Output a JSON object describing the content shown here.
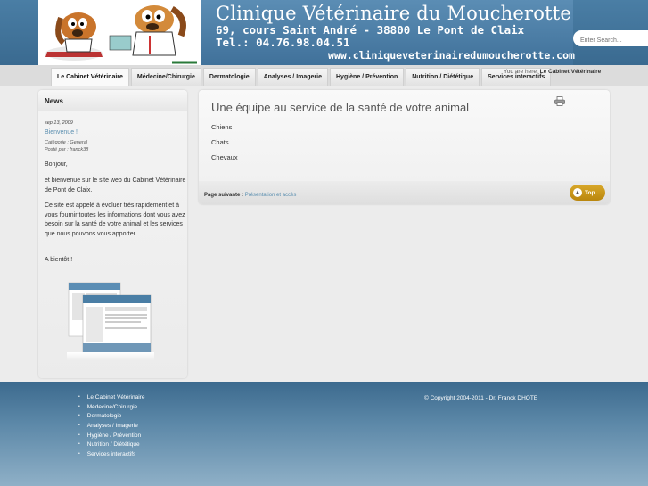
{
  "header": {
    "title": "Clinique Vétérinaire du Moucherotte",
    "address": "69, cours Saint André - 38800 Le Pont de Claix",
    "phone": "Tel.: 04.76.98.04.51",
    "url": "www.cliniqueveterinairedumoucherotte.com"
  },
  "search": {
    "placeholder": "Enter Search..."
  },
  "nav": {
    "items": [
      {
        "label": "Le Cabinet Vétérinaire"
      },
      {
        "label": "Médecine/Chirurgie"
      },
      {
        "label": "Dermatologie"
      },
      {
        "label": "Analyses / Imagerie"
      },
      {
        "label": "Hygiène / Prévention"
      },
      {
        "label": "Nutrition / Diététique"
      },
      {
        "label": "Services interactifs"
      }
    ]
  },
  "breadcrumb": {
    "prefix": "You are here:",
    "current": "Le Cabinet Vétérinaire"
  },
  "news": {
    "heading": "News",
    "date": "sep 13, 2009",
    "title": "Bienvenue !",
    "category": "Catégorie : General",
    "posted_by": "Posté par : franck38",
    "paragraphs": [
      "Bonjour,",
      "et bienvenue sur le site web du Cabinet Vétérinaire de Pont de Claix.",
      "Ce site est appelé à évoluer très rapidement et à vous fournir toutes les informations dont vous avez besoin sur la santé de votre animal et les services que nous pouvons vous apporter.",
      "A bientôt !"
    ]
  },
  "main": {
    "title": "Une équipe au service de la santé de votre animal",
    "animals": [
      "Chiens",
      "Chats",
      "Chevaux"
    ],
    "next_label": "Page suivante :",
    "next_link": "Présentation et accès",
    "top_button": "Top"
  },
  "footer": {
    "links": [
      "Le Cabinet Vétérinaire",
      "Médecine/Chirurgie",
      "Dermatologie",
      "Analyses / Imagerie",
      "Hygiène / Prévention",
      "Nutrition / Diététique",
      "Services interactifs"
    ],
    "copyright": "© Copyright 2004-2011 - Dr. Franck DHOTE"
  },
  "colors": {
    "header_blue": "#4a7ea5",
    "link_blue": "#5b8fb0",
    "top_button_gold": "#c99a1c"
  }
}
